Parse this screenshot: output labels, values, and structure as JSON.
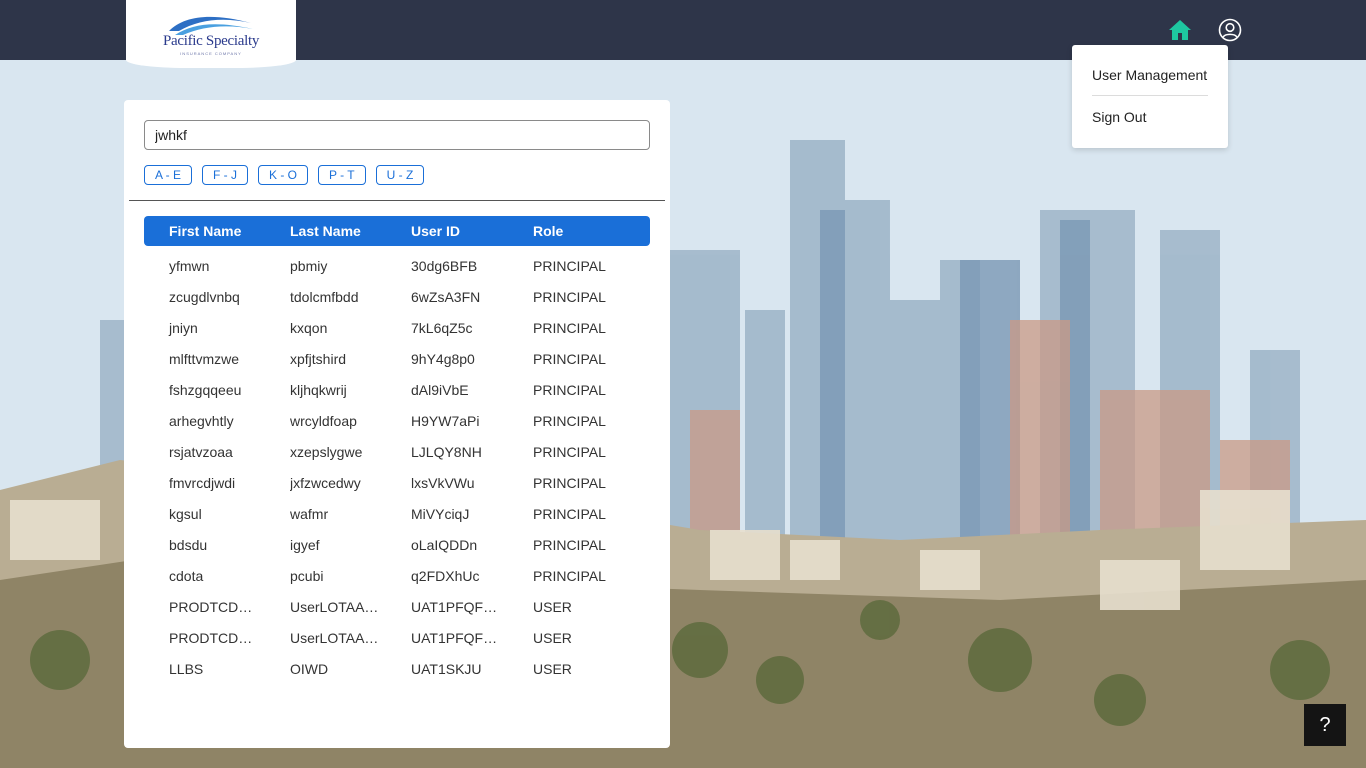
{
  "header": {
    "logo_text": "Pacific Specialty",
    "logo_subtext": "INSURANCE COMPANY",
    "home_icon": "home-icon",
    "account_icon": "user-circle-icon",
    "accent_color": "#1ec7a0",
    "bar_color": "#2e3549"
  },
  "user_menu": {
    "items": [
      "User Management",
      "Sign Out"
    ]
  },
  "search": {
    "value": "jwhkf"
  },
  "filters": [
    "A - E",
    "F - J",
    "K - O",
    "P - T",
    "U - Z"
  ],
  "table": {
    "columns": [
      "First Name",
      "Last Name",
      "User ID",
      "Role"
    ],
    "rows": [
      [
        "yfmwn",
        "pbmiy",
        "30dg6BFB",
        "PRINCIPAL"
      ],
      [
        "zcugdlvnbq",
        "tdolcmfbdd",
        "6wZsA3FN",
        "PRINCIPAL"
      ],
      [
        "jniyn",
        "kxqon",
        "7kL6qZ5c",
        "PRINCIPAL"
      ],
      [
        "mlfttvmzwe",
        "xpfjtshird",
        "9hY4g8p0",
        "PRINCIPAL"
      ],
      [
        "fshzgqqeeu",
        "kljhqkwrij",
        "dAl9iVbE",
        "PRINCIPAL"
      ],
      [
        "arhegvhtly",
        "wrcyldfoap",
        "H9YW7aPi",
        "PRINCIPAL"
      ],
      [
        "rsjatvzoaa",
        "xzepslygwe",
        "LJLQY8NH",
        "PRINCIPAL"
      ],
      [
        "fmvrcdjwdi",
        "jxfzwcedwy",
        "lxsVkVWu",
        "PRINCIPAL"
      ],
      [
        "kgsul",
        "wafmr",
        "MiVYciqJ",
        "PRINCIPAL"
      ],
      [
        "bdsdu",
        "igyef",
        "oLaIQDDn",
        "PRINCIPAL"
      ],
      [
        "cdota",
        "pcubi",
        "q2FDXhUc",
        "PRINCIPAL"
      ],
      [
        "PRODTCD…",
        "UserLOTAA…",
        "UAT1PFQF…",
        "USER"
      ],
      [
        "PRODTCD…",
        "UserLOTAA…",
        "UAT1PFQF…",
        "USER"
      ],
      [
        "LLBS",
        "OIWD",
        "UAT1SKJU",
        "USER"
      ]
    ],
    "header_color": "#1a6fd8"
  },
  "help": {
    "label": "?"
  }
}
